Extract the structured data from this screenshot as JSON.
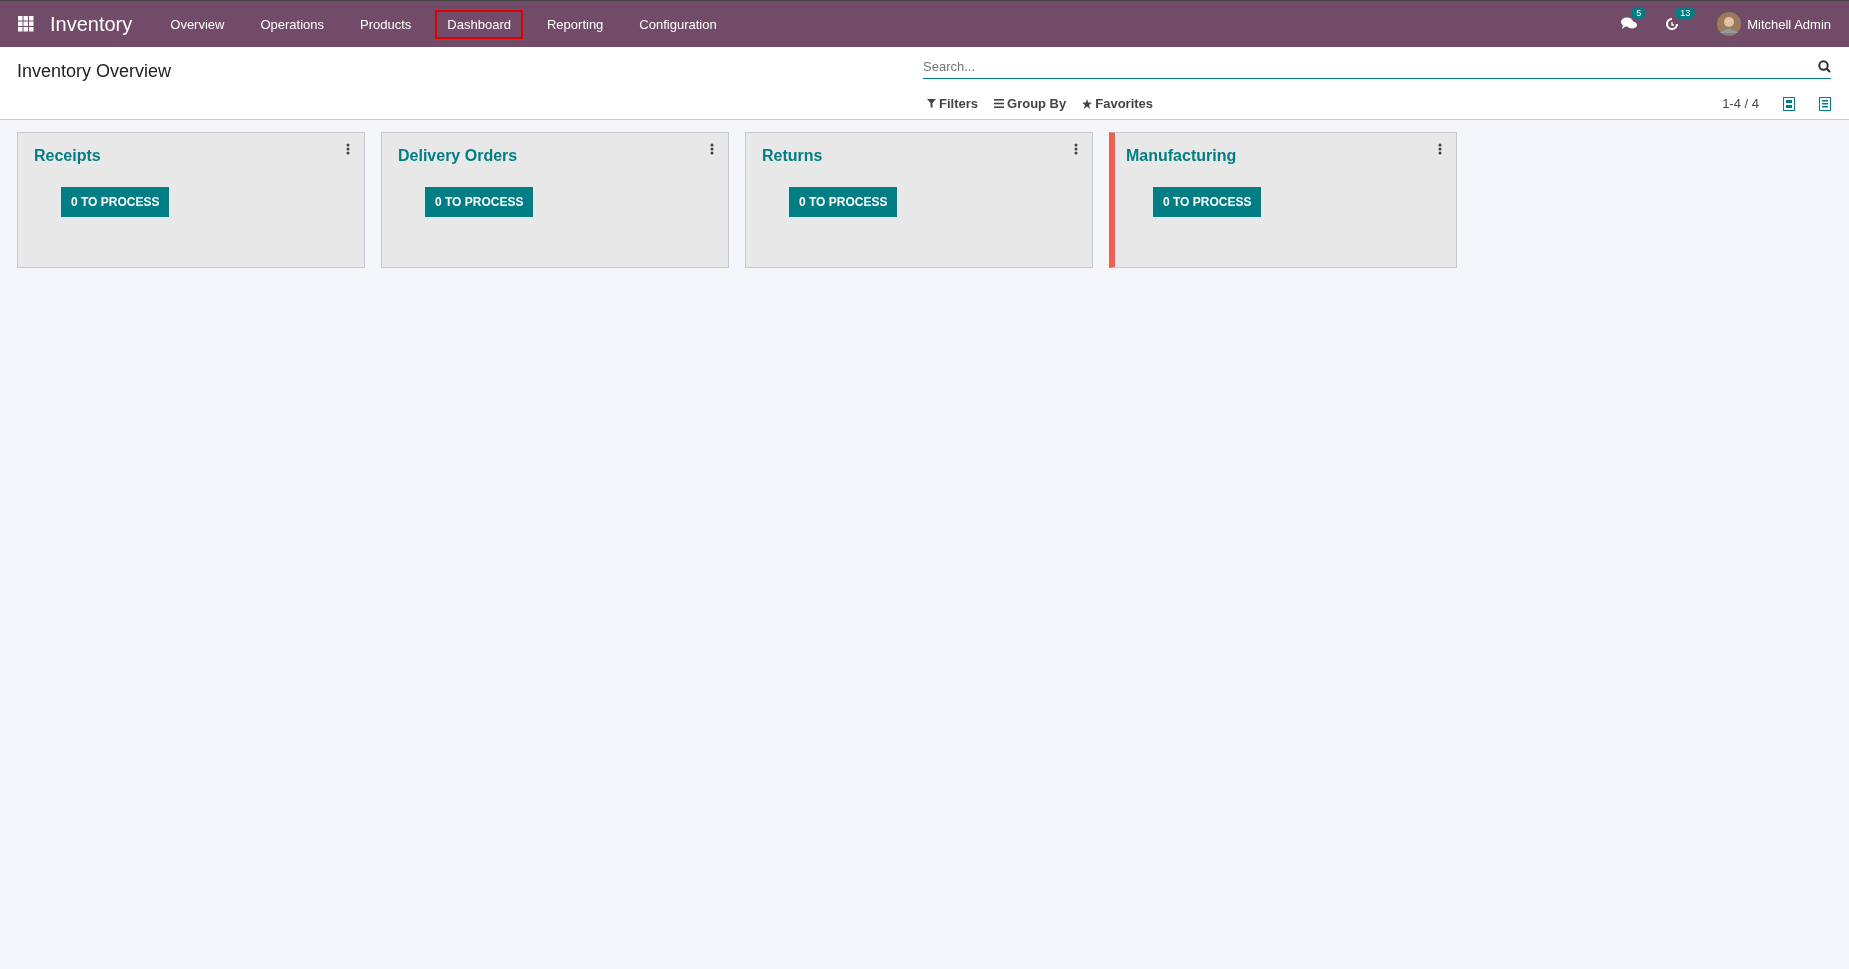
{
  "navbar": {
    "app_name": "Inventory",
    "menu": [
      {
        "label": "Overview",
        "highlighted": false
      },
      {
        "label": "Operations",
        "highlighted": false
      },
      {
        "label": "Products",
        "highlighted": false
      },
      {
        "label": "Dashboard",
        "highlighted": true
      },
      {
        "label": "Reporting",
        "highlighted": false
      },
      {
        "label": "Configuration",
        "highlighted": false
      }
    ],
    "messages_badge": "5",
    "activities_badge": "13",
    "user_name": "Mitchell Admin"
  },
  "control_panel": {
    "title": "Inventory Overview",
    "search": {
      "placeholder": "Search..."
    },
    "filters": [
      {
        "kind": "filter",
        "label": "Filters"
      },
      {
        "kind": "group",
        "label": "Group By"
      },
      {
        "kind": "favorite",
        "label": "Favorites"
      }
    ],
    "pager": "1-4 / 4"
  },
  "cards": [
    {
      "title": "Receipts",
      "button": "0 TO PROCESS"
    },
    {
      "title": "Delivery Orders",
      "button": "0 TO PROCESS"
    },
    {
      "title": "Returns",
      "button": "0 TO PROCESS"
    },
    {
      "title": "Manufacturing",
      "button": "0 TO PROCESS",
      "color": "#f06050"
    }
  ]
}
